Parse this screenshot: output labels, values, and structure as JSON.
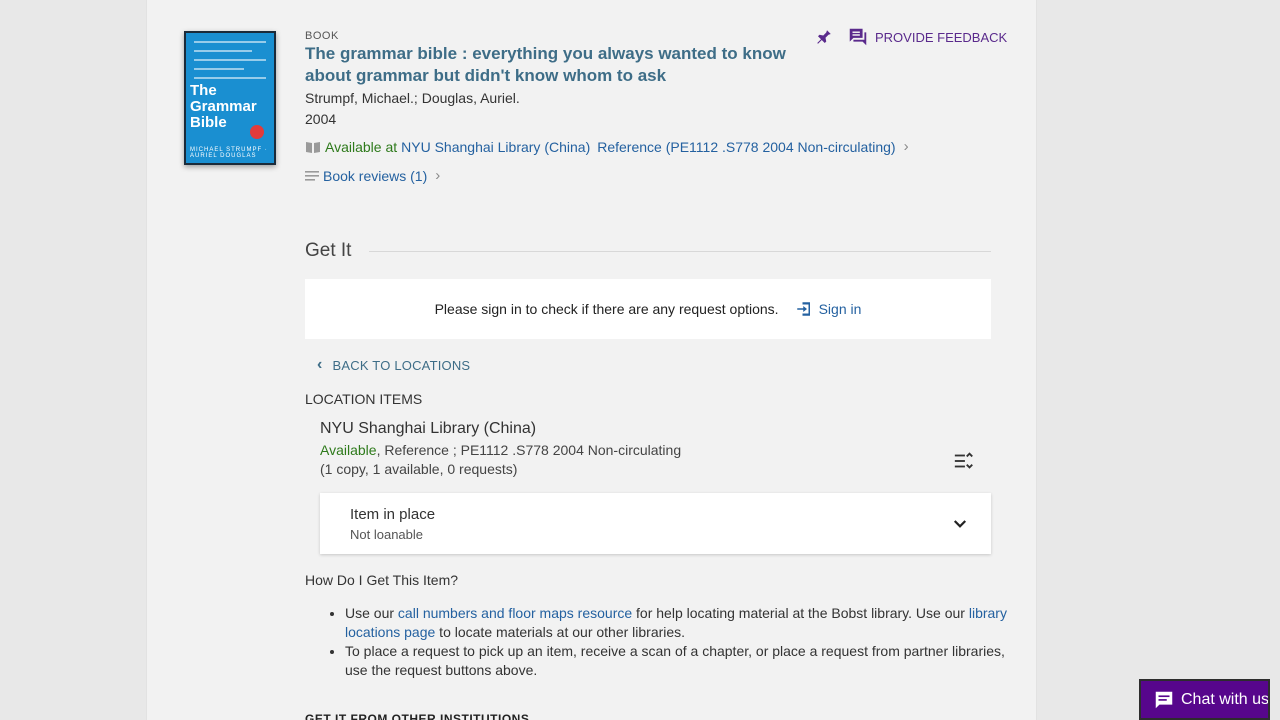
{
  "record": {
    "type_label": "BOOK",
    "title": "The grammar bible : everything you always wanted to know about grammar but didn't know whom to ask",
    "authors": "Strumpf, Michael.; Douglas, Auriel.",
    "year": "2004",
    "availability": {
      "status": "Available at",
      "library": "NYU Shanghai Library (China)",
      "location": "Reference (PE1112 .S778 2004 Non-circulating)"
    },
    "reviews_link": "Book reviews (1)",
    "cover": {
      "title": "The Grammar Bible",
      "authors": "MICHAEL STRUMPF · AURIEL DOUGLAS",
      "color": "#1a8fd1"
    }
  },
  "actions": {
    "pin_icon": "pin-icon",
    "feedback_label": "PROVIDE FEEDBACK"
  },
  "get_it": {
    "heading": "Get It",
    "signin_prompt": "Please sign in to check if there are any request options.",
    "signin_label": "Sign in",
    "back_label": "BACK TO LOCATIONS",
    "location_items_label": "LOCATION ITEMS",
    "location": {
      "name": "NYU Shanghai Library (China)",
      "status": "Available",
      "detail": ", Reference ; PE1112 .S778 2004 Non-circulating",
      "copies": "(1 copy, 1 available, 0 requests)"
    },
    "item": {
      "status": "Item in place",
      "policy": "Not loanable"
    },
    "how_heading": "How Do I Get This Item?",
    "help": {
      "b1_pre": "Use our ",
      "b1_link1": "call numbers and floor maps resource",
      "b1_mid": " for help locating material at the Bobst library. Use our ",
      "b1_link2": "library locations page",
      "b1_post": " to locate materials at our other libraries.",
      "b2": "To place a request to pick up an item, receive a scan of a chapter, or place a request from partner libraries, use the request buttons above."
    },
    "other_institutions": "GET IT FROM OTHER INSTITUTIONS"
  },
  "chat": {
    "label": "Chat with us"
  },
  "colors": {
    "accent_purple": "#57068c",
    "available_green": "#2e7a1b",
    "link_blue": "#2461a0",
    "title_blue": "#3e6d87"
  }
}
